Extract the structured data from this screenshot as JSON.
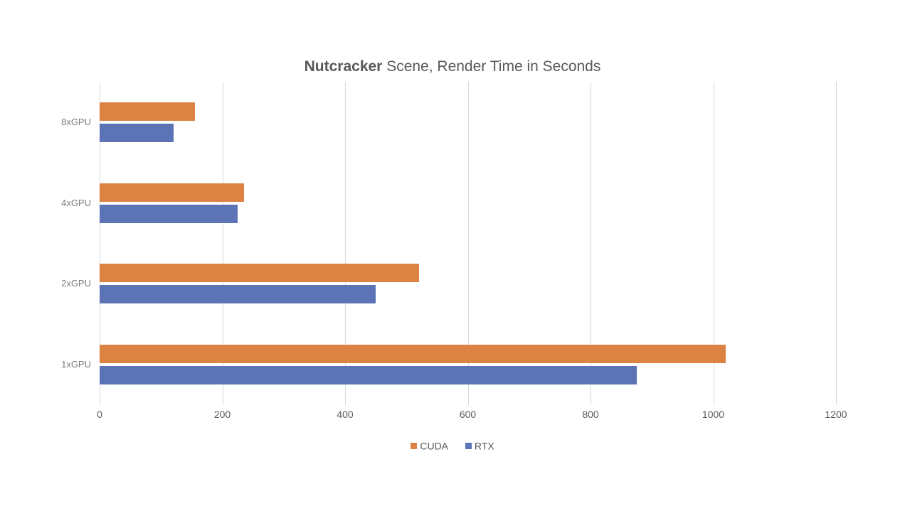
{
  "chart_data": {
    "type": "bar",
    "orientation": "horizontal",
    "title_bold": "Nutcracker",
    "title_rest": " Scene, Render Time in Seconds",
    "categories": [
      "8xGPU",
      "4xGPU",
      "2xGPU",
      "1xGPU"
    ],
    "series": [
      {
        "name": "CUDA",
        "color": "#dc8344",
        "values": [
          155,
          235,
          520,
          1020
        ]
      },
      {
        "name": "RTX",
        "color": "#5c74b6",
        "values": [
          120,
          225,
          450,
          875
        ]
      }
    ],
    "x_ticks": [
      0,
      200,
      400,
      600,
      800,
      1000,
      1200
    ],
    "xlim": [
      0,
      1200
    ],
    "xlabel": "",
    "ylabel": ""
  },
  "legend": {
    "cuda": "CUDA",
    "rtx": "RTX"
  },
  "ticks": {
    "t0": "0",
    "t200": "200",
    "t400": "400",
    "t600": "600",
    "t800": "800",
    "t1000": "1000",
    "t1200": "1200"
  },
  "ylabels": {
    "c0": "8xGPU",
    "c1": "4xGPU",
    "c2": "2xGPU",
    "c3": "1xGPU"
  }
}
